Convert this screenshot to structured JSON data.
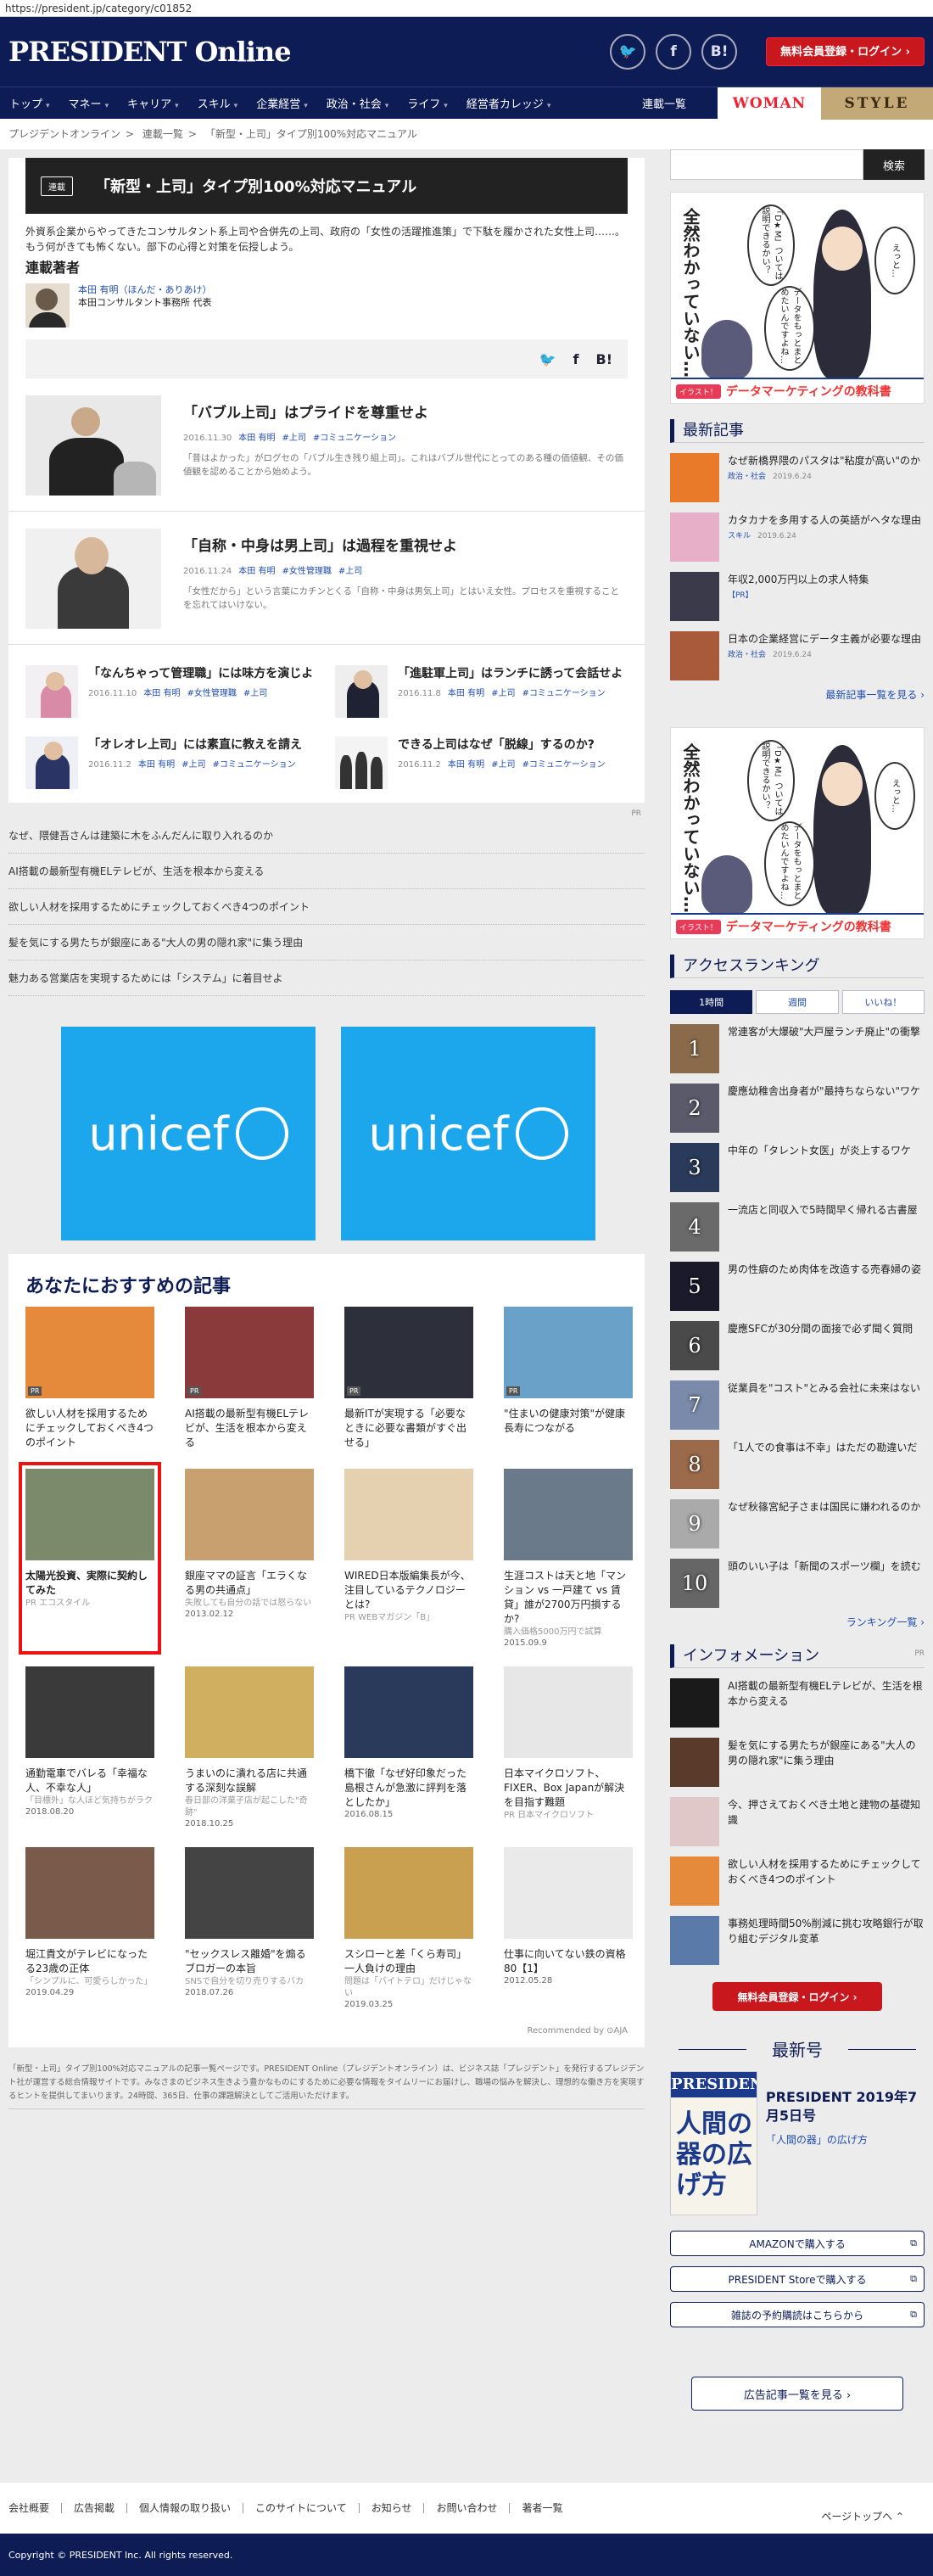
{
  "url": "https://president.jp/category/c01852",
  "header": {
    "logo": "PRESIDENT Online",
    "social": [
      "twitter-icon",
      "facebook-icon",
      "hatena-icon"
    ],
    "social_glyphs": [
      "🐦",
      "f",
      "B!"
    ],
    "login": "無料会員登録・ログイン ›"
  },
  "nav": {
    "items": [
      "トップ",
      "マネー",
      "キャリア",
      "スキル",
      "企業経営",
      "政治・社会",
      "ライフ",
      "経営者カレッジ"
    ],
    "series_list": "連載一覧",
    "brand_woman": "WOMAN",
    "brand_style": "STYLE"
  },
  "breadcrumb": [
    "プレジデントオンライン",
    "連載一覧",
    "「新型・上司」タイプ別100%対応マニュアル"
  ],
  "series": {
    "tag": "連載",
    "title": "「新型・上司」タイプ別100%対応マニュアル",
    "lead": "外資系企業からやってきたコンサルタント系上司や合併先の上司、政府の「女性の活躍推進策」で下駄を履かされた女性上司……。もう何がきても怖くない。部下の心得と対策を伝授しよう。",
    "authors_label": "連載著者",
    "author_name": "本田 有明（ほんだ・ありあけ）",
    "author_org": "本田コンサルタント事務所 代表",
    "share": [
      "🐦",
      "f",
      "B!"
    ]
  },
  "big_articles": [
    {
      "title": "「バブル上司」はプライドを尊重せよ",
      "date": "2016.11.30",
      "author": "本田 有明",
      "tags": [
        "#上司",
        "#コミュニケーション"
      ],
      "desc": "「昔はよかった」がログセの「バブル生き残り組上司」。これはバブル世代にとってのある種の価値観、その価値観を認めることから始めよう。"
    },
    {
      "title": "「自称・中身は男上司」は過程を重視せよ",
      "date": "2016.11.24",
      "author": "本田 有明",
      "tags": [
        "#女性管理職",
        "#上司"
      ],
      "desc": "「女性だから」という言葉にカチンとくる「自称・中身は男気上司」とはいえ女性。プロセスを重視することを忘れてはいけない。"
    }
  ],
  "small_articles": [
    {
      "title": "「なんちゃって管理職」には味方を演じよ",
      "date": "2016.11.10",
      "author": "本田 有明",
      "tags": [
        "#女性管理職",
        "#上司"
      ]
    },
    {
      "title": "「進駐軍上司」はランチに誘って会話せよ",
      "date": "2016.11.8",
      "author": "本田 有明",
      "tags": [
        "#上司",
        "#コミュニケーション"
      ]
    },
    {
      "title": "「オレオレ上司」には素直に教えを請え",
      "date": "2016.11.2",
      "author": "本田 有明",
      "tags": [
        "#上司",
        "#コミュニケーション"
      ]
    },
    {
      "title": "できる上司はなぜ「脱線」するのか?",
      "date": "2016.11.2",
      "author": "本田 有明",
      "tags": [
        "#上司",
        "#コミュニケーション"
      ]
    }
  ],
  "pr_label": "PR",
  "pr_links": [
    "なぜ、隈健吾さんは建築に木をふんだんに取り入れるのか",
    "AI搭載の最新型有機ELテレビが、生活を根本から変える",
    "欲しい人材を採用するためにチェックしておくべき4つのポイント",
    "髪を気にする男たちが銀座にある\"大人の男の隠れ家\"に集う理由",
    "魅力ある営業店を実現するためには「システム」に着目せよ"
  ],
  "unicef": [
    "unicef",
    "unicef"
  ],
  "recommend": {
    "title": "あなたにおすすめの記事",
    "items": [
      {
        "title": "欲しい人材を採用するためにチェックしておくべき4つのポイント",
        "sub": "",
        "date": "",
        "pr": "PR",
        "hl": false
      },
      {
        "title": "AI搭載の最新型有機ELテレビが、生活を根本から変える",
        "sub": "",
        "date": "",
        "pr": "PR",
        "hl": false
      },
      {
        "title": "最新ITが実現する「必要なときに必要な書類がすぐ出せる」",
        "sub": "",
        "date": "",
        "pr": "PR",
        "hl": false
      },
      {
        "title": "\"住まいの健康対策\"が健康長寿につながる",
        "sub": "",
        "date": "",
        "pr": "PR",
        "hl": false
      },
      {
        "title": "太陽光投資、実際に契約してみた",
        "sub": "PR エコスタイル",
        "date": "",
        "pr": "",
        "hl": true
      },
      {
        "title": "銀座ママの証言「エラくなる男の共通点」",
        "sub": "失敗しても自分の話では怒らない",
        "date": "2013.02.12",
        "pr": "",
        "hl": false
      },
      {
        "title": "WIRED日本版編集長が今、注目しているテクノロジーとは?",
        "sub": "PR WEBマガジン「B」",
        "date": "",
        "pr": "",
        "hl": false
      },
      {
        "title": "生涯コストは天と地「マンション vs 一戸建て vs 賃貸」誰が2700万円損するか?",
        "sub": "購入価格5000万円で試算",
        "date": "2015.09.9",
        "pr": "",
        "hl": false
      },
      {
        "title": "通勤電車でバレる「幸福な人、不幸な人」",
        "sub": "「目標外」な人ほど気持ちがラク",
        "date": "2018.08.20",
        "pr": "",
        "hl": false
      },
      {
        "title": "うまいのに潰れる店に共通する深刻な誤解",
        "sub": "春日部の洋菓子店が起こした\"奇跡\"",
        "date": "2018.10.25",
        "pr": "",
        "hl": false
      },
      {
        "title": "橋下徹「なぜ好印象だった島根さんが急激に評判を落としたか」",
        "sub": "",
        "date": "2016.08.15",
        "pr": "",
        "hl": false
      },
      {
        "title": "日本マイクロソフト、FIXER、Box Japanが解決を目指す難題",
        "sub": "PR 日本マイクロソフト",
        "date": "",
        "pr": "",
        "hl": false
      },
      {
        "title": "堀江貴文がテレビになったる23歳の正体",
        "sub": "「シンプルに、可愛らしかった」",
        "date": "2019.04.29",
        "pr": "",
        "hl": false
      },
      {
        "title": "\"セックスレス離婚\"を煽るブロガーの本旨",
        "sub": "SNSで自分を切り売りするバカ",
        "date": "2018.07.26",
        "pr": "",
        "hl": false
      },
      {
        "title": "スシローと差「くら寿司」一人負けの理由",
        "sub": "問題は「バイトテロ」だけじゃない",
        "date": "2019.03.25",
        "pr": "",
        "hl": false
      },
      {
        "title": "仕事に向いてない鉄の資格80【1】",
        "sub": "",
        "date": "2012.05.28",
        "pr": "",
        "hl": false
      }
    ],
    "powered": "Recommended by ⊙AJA"
  },
  "footer_text": "「新型・上司」タイプ別100%対応マニュアルの記事一覧ページです。PRESIDENT Online（プレジデントオンライン）は、ビジネス誌「プレジデント」を発行するプレジデント社が運営する総合情報サイトです。みなさまのビジネス生きよう豊かなものにするために必要な情報をタイムリーにお届けし、職場の悩みを解決し、理想的な働き方を実現するヒントを提供してまいります。24時間、365日、仕事の課題解決としてご活用いただけます。",
  "sidebar": {
    "search_btn": "検索",
    "ad": {
      "q": "全然わかっていない…",
      "b1": "「D★M」ついては説明できるかい？",
      "b2": "データをもっとまとめたいんですよね…",
      "b3": "えっと…",
      "x": "イラスト！",
      "y": "データマーケティングの教科書"
    },
    "latest_title": "最新記事",
    "latest": [
      {
        "title": "なぜ新橋界隈のパスタは\"粘度が高い\"のか",
        "tag": "政治・社会",
        "date": "2019.6.24"
      },
      {
        "title": "カタカナを多用する人の英語がヘタな理由",
        "tag": "スキル",
        "date": "2019.6.24"
      },
      {
        "title": "年収2,000万円以上の求人特集",
        "tag": "【PR】",
        "date": ""
      },
      {
        "title": "日本の企業経営にデータ主義が必要な理由",
        "tag": "政治・社会",
        "date": "2019.6.24"
      }
    ],
    "latest_more": "最新記事一覧を見る ›",
    "ranking_title": "アクセスランキング",
    "tabs": [
      "1時間",
      "週間",
      "いいね！"
    ],
    "ranking": [
      "常連客が大爆破\"大戸屋ランチ廃止\"の衝撃",
      "慶應幼稚舎出身者が\"最持ちならない\"ワケ",
      "中年の「タレント女医」が炎上するワケ",
      "一流店と同収入で5時間早く帰れる古書屋",
      "男の性癖のため肉体を改造する売春婦の姿",
      "慶應SFCが30分間の面接で必ず聞く質問",
      "従業員を\"コスト\"とみる会社に未来はない",
      "「1人での食事は不幸」はただの勘違いだ",
      "なぜ秋篠宮紀子さまは国民に嫌われるのか",
      "頭のいい子は「新聞のスポーツ欄」を読む"
    ],
    "ranking_more": "ランキング一覧 ›",
    "info_title": "インフォメーション",
    "info_pr": "PR",
    "info": [
      "AI搭載の最新型有機ELテレビが、生活を根本から変える",
      "髪を気にする男たちが銀座にある\"大人の男の隠れ家\"に集う理由",
      "今、押さえておくべき土地と建物の基礎知識",
      "欲しい人材を採用するためにチェックしておくべき4つのポイント",
      "事務処理時間50%削減に挑む攻略銀行が取り組むデジタル変革"
    ],
    "login": "無料会員登録・ログイン ›",
    "latest_issue": "最新号",
    "magazine": {
      "logo": "PRESIDENT",
      "cover": "人間の器の広げ方",
      "name": "PRESIDENT 2019年7月5日号",
      "feature": "「人間の器」の広げ方"
    },
    "buy": [
      "AMAZONで購入する",
      "PRESIDENT Storeで購入する",
      "雑誌の予約購読はこちらから"
    ],
    "ad_list": "広告記事一覧を見る ›"
  },
  "footer_nav": [
    "会社概要",
    "広告掲載",
    "個人情報の取り扱い",
    "このサイトについて",
    "お知らせ",
    "お問い合わせ",
    "著者一覧"
  ],
  "page_top": "ページトップへ ⌃",
  "copyright": "Copyright © PRESIDENT Inc. All rights reserved."
}
